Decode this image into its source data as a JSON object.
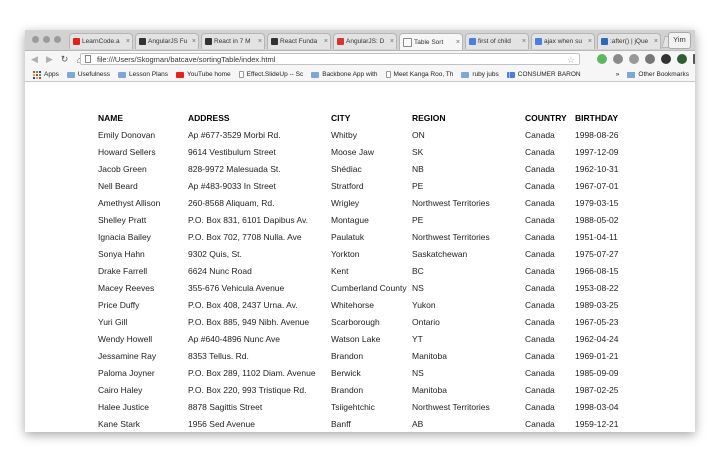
{
  "browser": {
    "tabs": [
      {
        "title": "LearnCode.a",
        "icon": "youtube-icon",
        "color": "#e62117"
      },
      {
        "title": "AngularJS Fu",
        "icon": "github-icon",
        "color": "#333333"
      },
      {
        "title": "React in 7 M",
        "icon": "github-icon",
        "color": "#333333"
      },
      {
        "title": "React Funda",
        "icon": "github-icon",
        "color": "#333333"
      },
      {
        "title": "AngularJS: D",
        "icon": "angular-icon",
        "color": "#d6342f"
      },
      {
        "title": "Table Sort",
        "icon": "page-icon",
        "color": "#ffffff"
      },
      {
        "title": "first of child",
        "icon": "google-icon",
        "color": "#4a7ee3"
      },
      {
        "title": "ajax when su",
        "icon": "google-icon",
        "color": "#4a7ee3"
      },
      {
        "title": ":after() | jQue",
        "icon": "jquery-icon",
        "color": "#2a6ab8"
      }
    ],
    "profile_name": "Yim",
    "url": "file:///Users/Skogman/batcave/sortingTable/index.html",
    "bookmarks": [
      {
        "label": "Apps",
        "type": "apps"
      },
      {
        "label": "Usefulness",
        "type": "folder"
      },
      {
        "label": "Lesson Plans",
        "type": "folder"
      },
      {
        "label": "YouTube home",
        "type": "youtube"
      },
      {
        "label": "Effect.SlideUp -- Sc",
        "type": "page"
      },
      {
        "label": "Backbone App with",
        "type": "folder"
      },
      {
        "label": "Meet Kanga Roo, Th",
        "type": "page"
      },
      {
        "label": "ruby jubs",
        "type": "folder"
      },
      {
        "label": "CONSUMER BARON",
        "type": "chart"
      }
    ],
    "overflow_label": "»",
    "other_bookmarks": "Other Bookmarks"
  },
  "table": {
    "headers": [
      "NAME",
      "ADDRESS",
      "CITY",
      "REGION",
      "COUNTRY",
      "BIRTHDAY"
    ],
    "rows": [
      [
        "Emily Donovan",
        "Ap #677-3529 Morbi Rd.",
        "Whitby",
        "ON",
        "Canada",
        "1998-08-26"
      ],
      [
        "Howard Sellers",
        "9614 Vestibulum Street",
        "Moose Jaw",
        "SK",
        "Canada",
        "1997-12-09"
      ],
      [
        "Jacob Green",
        "828-9972 Malesuada St.",
        "Shédiac",
        "NB",
        "Canada",
        "1962-10-31"
      ],
      [
        "Nell Beard",
        "Ap #483-9033 In Street",
        "Stratford",
        "PE",
        "Canada",
        "1967-07-01"
      ],
      [
        "Amethyst Allison",
        "260-8568 Aliquam, Rd.",
        "Wrigley",
        "Northwest Territories",
        "Canada",
        "1979-03-15"
      ],
      [
        "Shelley Pratt",
        "P.O. Box 831, 6101 Dapibus Av.",
        "Montague",
        "PE",
        "Canada",
        "1988-05-02"
      ],
      [
        "Ignacia Bailey",
        "P.O. Box 702, 7708 Nulla. Ave",
        "Paulatuk",
        "Northwest Territories",
        "Canada",
        "1951-04-11"
      ],
      [
        "Sonya Hahn",
        "9302 Quis, St.",
        "Yorkton",
        "Saskatchewan",
        "Canada",
        "1975-07-27"
      ],
      [
        "Drake Farrell",
        "6624 Nunc Road",
        "Kent",
        "BC",
        "Canada",
        "1966-08-15"
      ],
      [
        "Macey Reeves",
        "355-676 Vehicula Avenue",
        "Cumberland County",
        "NS",
        "Canada",
        "1953-08-22"
      ],
      [
        "Price Duffy",
        "P.O. Box 408, 2437 Urna. Av.",
        "Whitehorse",
        "Yukon",
        "Canada",
        "1989-03-25"
      ],
      [
        "Yuri Gill",
        "P.O. Box 885, 949 Nibh. Avenue",
        "Scarborough",
        "Ontario",
        "Canada",
        "1967-05-23"
      ],
      [
        "Wendy Howell",
        "Ap #640-4896 Nunc Ave",
        "Watson Lake",
        "YT",
        "Canada",
        "1962-04-24"
      ],
      [
        "Jessamine Ray",
        "8353 Tellus. Rd.",
        "Brandon",
        "Manitoba",
        "Canada",
        "1969-01-21"
      ],
      [
        "Paloma Joyner",
        "P.O. Box 289, 1102 Diam. Avenue",
        "Berwick",
        "NS",
        "Canada",
        "1985-09-09"
      ],
      [
        "Cairo Haley",
        "P.O. Box 220, 993 Tristique Rd.",
        "Brandon",
        "Manitoba",
        "Canada",
        "1987-02-25"
      ],
      [
        "Halee Justice",
        "8878 Sagittis Street",
        "Tsiigehtchic",
        "Northwest Territories",
        "Canada",
        "1998-03-04"
      ],
      [
        "Kane Stark",
        "1956 Sed Avenue",
        "Banff",
        "AB",
        "Canada",
        "1959-12-21"
      ]
    ]
  }
}
